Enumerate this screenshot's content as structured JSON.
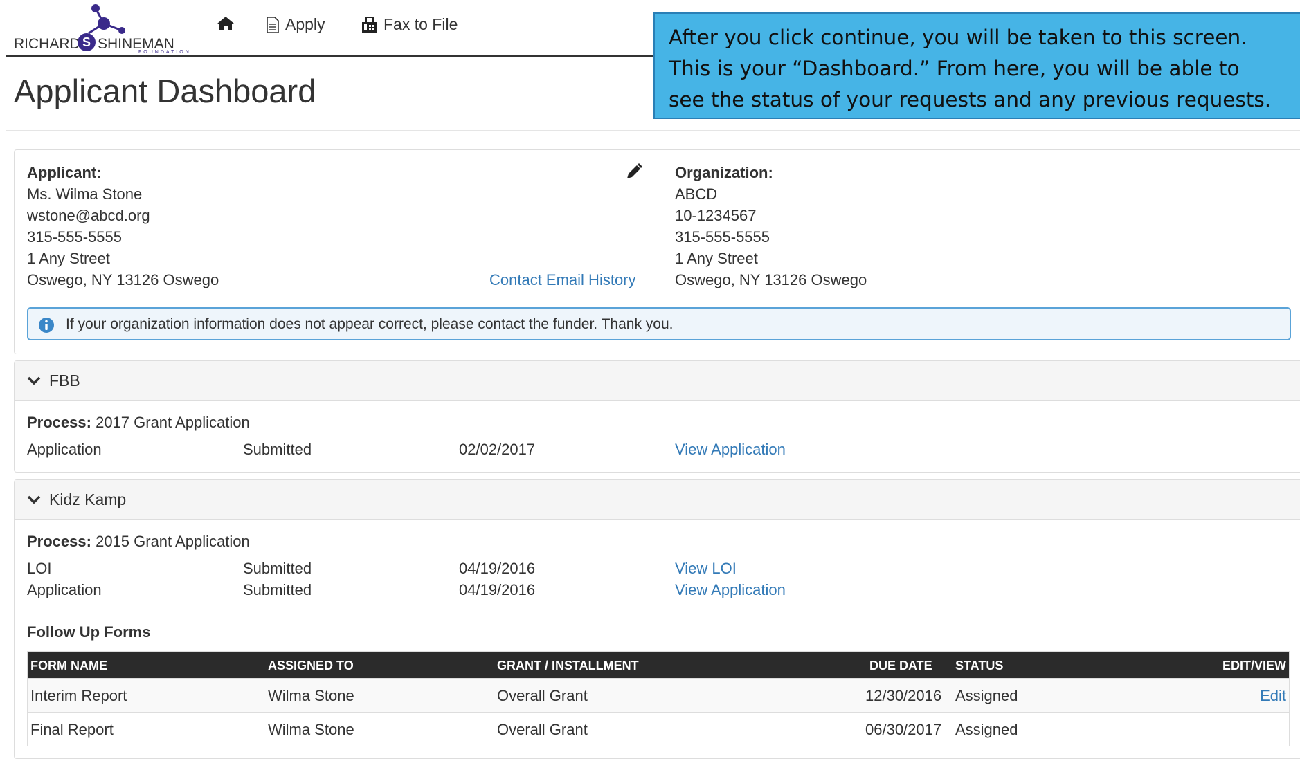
{
  "header": {
    "logo": {
      "name_left": "RICHARD",
      "name_initial": "S",
      "name_right": "SHINEMAN",
      "subtitle": "FOUNDATION"
    },
    "nav": {
      "apply": "Apply",
      "fax": "Fax to File"
    }
  },
  "callout": {
    "lines": [
      "After you click continue, you will be taken to this screen.",
      "This is your “Dashboard.” From here, you will be able to",
      "see the status of your requests and any previous requests."
    ]
  },
  "page_title": "Applicant Dashboard",
  "applicant": {
    "heading": "Applicant:",
    "name": "Ms. Wilma Stone",
    "email": "wstone@abcd.org",
    "phone": "315-555-5555",
    "street": "1 Any Street",
    "city": "Oswego, NY 13126 Oswego",
    "email_history_link": "Contact Email History"
  },
  "organization": {
    "heading": "Organization:",
    "name": "ABCD",
    "ein": "10-1234567",
    "phone": "315-555-5555",
    "street": "1 Any Street",
    "city": "Oswego, NY 13126 Oswego"
  },
  "info_message": "If your organization information does not appear correct, please contact the funder. Thank you.",
  "programs": [
    {
      "name": "FBB",
      "process_label": "Process:",
      "process": "2017 Grant Application",
      "rows": [
        {
          "type": "Application",
          "status": "Submitted",
          "date": "02/02/2017",
          "link": "View Application"
        }
      ]
    },
    {
      "name": "Kidz Kamp",
      "process_label": "Process:",
      "process": "2015 Grant Application",
      "rows": [
        {
          "type": "LOI",
          "status": "Submitted",
          "date": "04/19/2016",
          "link": "View LOI"
        },
        {
          "type": "Application",
          "status": "Submitted",
          "date": "04/19/2016",
          "link": "View Application"
        }
      ],
      "follow_up": {
        "heading": "Follow Up Forms",
        "columns": [
          "FORM NAME",
          "ASSIGNED TO",
          "GRANT / INSTALLMENT",
          "DUE DATE",
          "STATUS",
          "EDIT/VIEW"
        ],
        "rows": [
          {
            "form_name": "Interim Report",
            "assigned_to": "Wilma Stone",
            "grant": "Overall Grant",
            "due_date": "12/30/2016",
            "status": "Assigned",
            "action": "Edit"
          },
          {
            "form_name": "Final Report",
            "assigned_to": "Wilma Stone",
            "grant": "Overall Grant",
            "due_date": "06/30/2017",
            "status": "Assigned",
            "action": ""
          }
        ]
      }
    }
  ],
  "colors": {
    "link": "#337ab7",
    "callout_bg": "#46b4e6",
    "table_header": "#2b2b2b",
    "logo_purple": "#3a2a8a"
  }
}
